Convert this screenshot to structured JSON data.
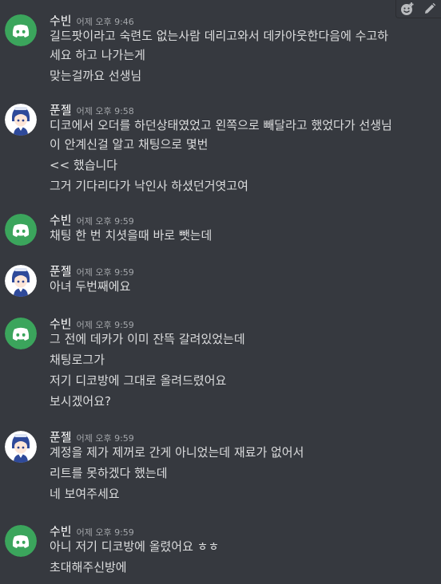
{
  "messages": [
    {
      "user": "수빈",
      "time": "어제 오후 9:46",
      "avatar": "discord-logo-icon",
      "lines": [
        "길드팟이라고 숙련도 없는사람 데리고와서 데카아웃한다음에 수고하",
        "세요 하고 나가는게",
        "맞는걸까요 선생님"
      ]
    },
    {
      "user": "푼젤",
      "time": "어제 오후 9:58",
      "avatar": "anime-character-avatar",
      "lines": [
        "디코에서 오더를 하던상태였었고 왼쪽으로 빼달라고 했었다가 선생님",
        "이 안계신걸 알고 채팅으로 몇번",
        "<< 했습니다",
        "그거 기다리다가 낙인사 하셨던거엿고여"
      ]
    },
    {
      "user": "수빈",
      "time": "어제 오후 9:59",
      "avatar": "discord-logo-icon",
      "lines": [
        "채팅 한 번 치셧을때 바로 뺏는데"
      ]
    },
    {
      "user": "푼젤",
      "time": "어제 오후 9:59",
      "avatar": "anime-character-avatar",
      "lines": [
        "아녀 두번째에요"
      ]
    },
    {
      "user": "수빈",
      "time": "어제 오후 9:59",
      "avatar": "discord-logo-icon",
      "lines": [
        "그 전에 데카가 이미 잔뜩 갈려있었는데",
        "채팅로그가",
        "저기 디코방에 그대로 올려드렸어요",
        "보시겠어요?"
      ]
    },
    {
      "user": "푼젤",
      "time": "어제 오후 9:59",
      "avatar": "anime-character-avatar",
      "lines": [
        "계정을 제가 제꺼로 간게 아니었는데 재료가 없어서",
        "리트를 못하겠다 했는데",
        "네 보여주세요"
      ]
    },
    {
      "user": "수빈",
      "time": "어제 오후 9:59",
      "avatar": "discord-logo-icon",
      "lines": [
        "아니 저기 디코방에 올렸어요 ㅎㅎ",
        "초대해주신방에"
      ]
    }
  ],
  "toolbar": {
    "icons": [
      "add-reaction-icon",
      "edit-icon"
    ]
  },
  "colors": {
    "background": "#36393f",
    "discord_avatar_bg": "#3ba55c",
    "username": "#ffffff",
    "message_text": "#dcddde",
    "timestamp": "#a3a6aa"
  }
}
